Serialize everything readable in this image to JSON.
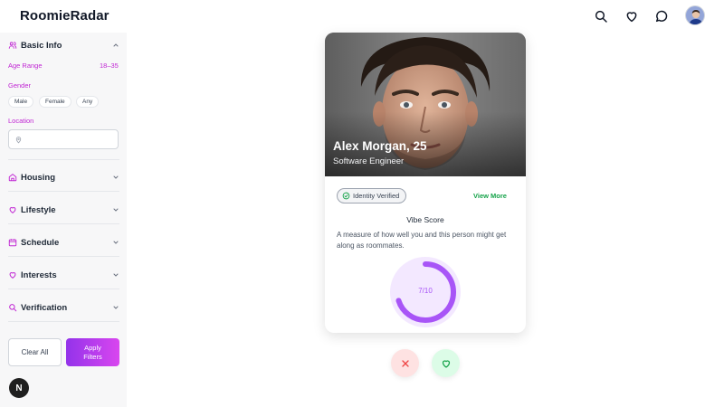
{
  "header": {
    "brand": "RoomieRadar",
    "icons": [
      "search-icon",
      "heart-icon",
      "chat-icon",
      "user-avatar"
    ]
  },
  "sidebar": {
    "basic_info": {
      "title": "Basic Info",
      "age_label": "Age Range",
      "age_value": "18–35",
      "gender_label": "Gender",
      "gender_options": [
        "Male",
        "Female",
        "Any"
      ],
      "location_label": "Location",
      "location_placeholder": "",
      "expanded": true
    },
    "sections": [
      {
        "title": "Housing",
        "icon": "home-icon"
      },
      {
        "title": "Lifestyle",
        "icon": "heart-icon"
      },
      {
        "title": "Schedule",
        "icon": "calendar-icon"
      },
      {
        "title": "Interests",
        "icon": "heart-icon"
      },
      {
        "title": "Verification",
        "icon": "search-icon"
      }
    ],
    "clear_label": "Clear All",
    "apply_label": "Apply Filters",
    "badge": "N"
  },
  "card": {
    "name": "Alex Morgan, 25",
    "job": "Software Engineer",
    "verified_label": "Identity Verified",
    "view_more": "View More",
    "vibe_title": "Vibe Score",
    "vibe_desc": "A measure of how well you and this person might get along as roommates.",
    "vibe_label": "7/10",
    "vibe_score": 7,
    "vibe_max": 10
  },
  "colors": {
    "accent": "#c026d3",
    "gauge": "#a855f7",
    "gauge_bg": "#f3e8ff",
    "success": "#16a34a",
    "danger": "#ef4444"
  }
}
